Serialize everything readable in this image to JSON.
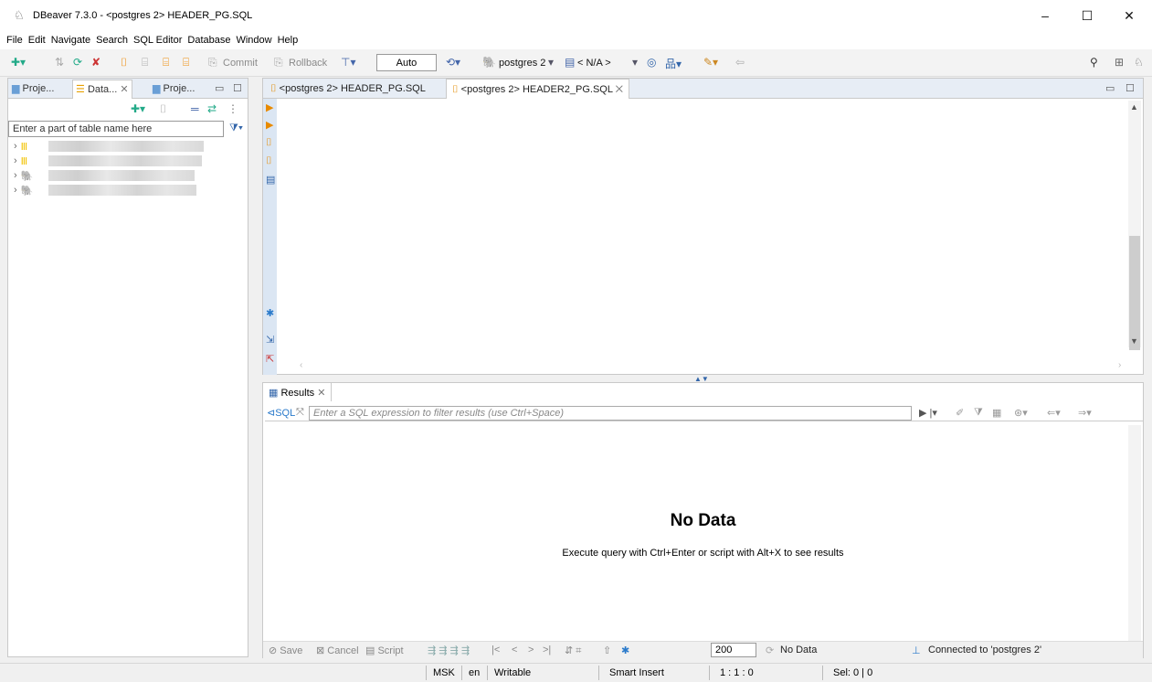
{
  "window": {
    "title": "DBeaver 7.3.0 - <postgres 2> HEADER_PG.SQL",
    "minimize": "–",
    "maximize": "☐",
    "close": "✕"
  },
  "menu": [
    "File",
    "Edit",
    "Navigate",
    "Search",
    "SQL Editor",
    "Database",
    "Window",
    "Help"
  ],
  "toolbar": {
    "commit": "Commit",
    "rollback": "Rollback",
    "transaction_mode": "Auto",
    "connection": "postgres 2",
    "schema": "< N/A >"
  },
  "navigator": {
    "tabs": [
      "Proje...",
      "Data...",
      "Proje..."
    ],
    "filter_placeholder": "Enter a part of table name here"
  },
  "editor": {
    "tabs": [
      "<postgres 2> HEADER_PG.SQL",
      "<postgres 2> HEADER2_PG.SQL"
    ]
  },
  "results": {
    "tab_label": "Results",
    "sql_label": "SQL",
    "filter_placeholder": "Enter a SQL expression to filter results (use Ctrl+Space)",
    "empty_title": "No Data",
    "empty_hint": "Execute query with Ctrl+Enter or script with Alt+X to see results",
    "bottom": {
      "save": "Save",
      "cancel": "Cancel",
      "script": "Script",
      "fetch_size": "200",
      "status": "No Data",
      "connection": "Connected to 'postgres 2'"
    }
  },
  "statusbar": {
    "timezone": "MSK",
    "locale": "en",
    "mode": "Writable",
    "insert": "Smart Insert",
    "position": "1 : 1 : 0",
    "selection": "Sel: 0 | 0"
  }
}
